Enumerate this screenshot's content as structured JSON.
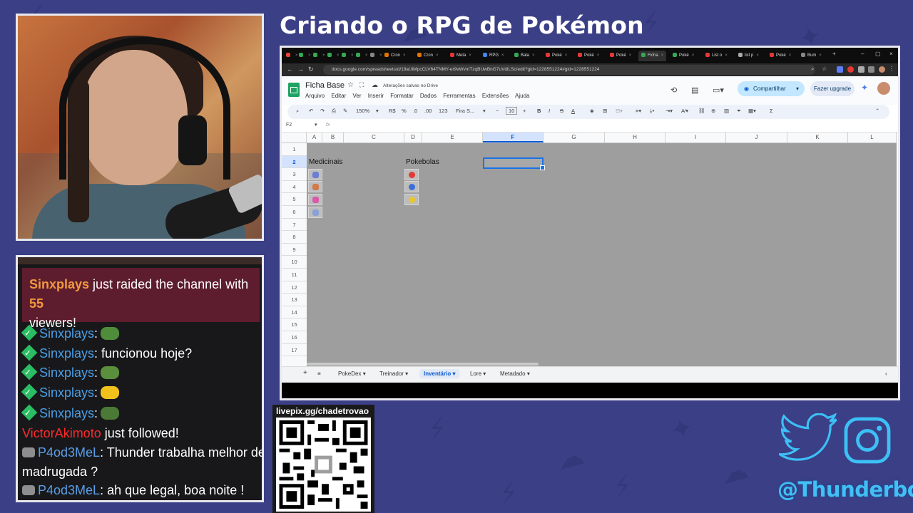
{
  "stream": {
    "title": "Criando o RPG de Pokémon",
    "qr_label": "livepix.gg/chadetrovao",
    "handle": "@Thunderbout"
  },
  "chat": {
    "raid": {
      "user": "Sinxplays",
      "text1": " just raided the channel with ",
      "count": "55",
      "text2": "viewers!"
    },
    "messages": [
      {
        "user": "Sinxplays",
        "text": ":"
      },
      {
        "user": "Sinxplays",
        "text": ": funcionou hoje?"
      },
      {
        "user": "Sinxplays",
        "text": ":"
      },
      {
        "user": "Sinxplays",
        "text": ":"
      },
      {
        "user": "Sinxplays",
        "text": ":"
      }
    ],
    "follow": {
      "user": "VictorAkimoto",
      "text": " just followed!"
    },
    "p4": [
      {
        "user": "P4od3MeL",
        "text": ": Thunder trabalha melhor de",
        "cont": "madrugada ?"
      },
      {
        "user": "P4od3MeL",
        "text": ": ah que legal, boa noite !"
      }
    ]
  },
  "browser": {
    "tabs": [
      "Cron",
      "Cron",
      "Meta",
      "RPG",
      "Bala",
      "Poké",
      "Poké",
      "Poké",
      "Ficha",
      "Poké",
      "List o",
      "list p",
      "Poké",
      "Bum"
    ],
    "url": "docs.google.com/spreadsheets/d/19aUiMpcCLV64TNMY-er9vWvmTzqBUwBnG7uVdlLSc/edit?gid=1228551224#gid=1228551224"
  },
  "sheets": {
    "doc_name": "Ficha Base",
    "save_status": "Alterações salvas no Drive",
    "menus": [
      "Arquivo",
      "Editar",
      "Ver",
      "Inserir",
      "Formatar",
      "Dados",
      "Ferramentas",
      "Extensões",
      "Ajuda"
    ],
    "share_label": "Compartilhar",
    "upgrade_label": "Fazer upgrade",
    "toolbar": {
      "zoom": "150%",
      "currency": "R$",
      "percent": "%",
      "dec_less": ".0",
      "dec_more": ".00",
      "numfmt": "123",
      "font": "Fira S...",
      "font_size": "10"
    },
    "cell_ref": "F2",
    "fx": "fx",
    "columns": [
      "A",
      "B",
      "C",
      "D",
      "E",
      "F",
      "G",
      "H",
      "I",
      "J",
      "K",
      "L"
    ],
    "rows": [
      "1",
      "2",
      "3",
      "4",
      "5",
      "6",
      "7",
      "8",
      "9",
      "10",
      "11",
      "12",
      "13",
      "14",
      "15",
      "16",
      "17"
    ],
    "label_medicinais": "Medicinais",
    "label_pokebolas": "Pokebolas",
    "sheet_tabs": [
      "PokeDex",
      "Treinador",
      "Inventário",
      "Lore",
      "Metadado"
    ],
    "active_tab": "Inventário"
  },
  "colors": {
    "background": "#3b3f86",
    "raid_bg": "#5e1d2e",
    "accent_blue": "#1a73e8",
    "handle": "#42bff5"
  }
}
